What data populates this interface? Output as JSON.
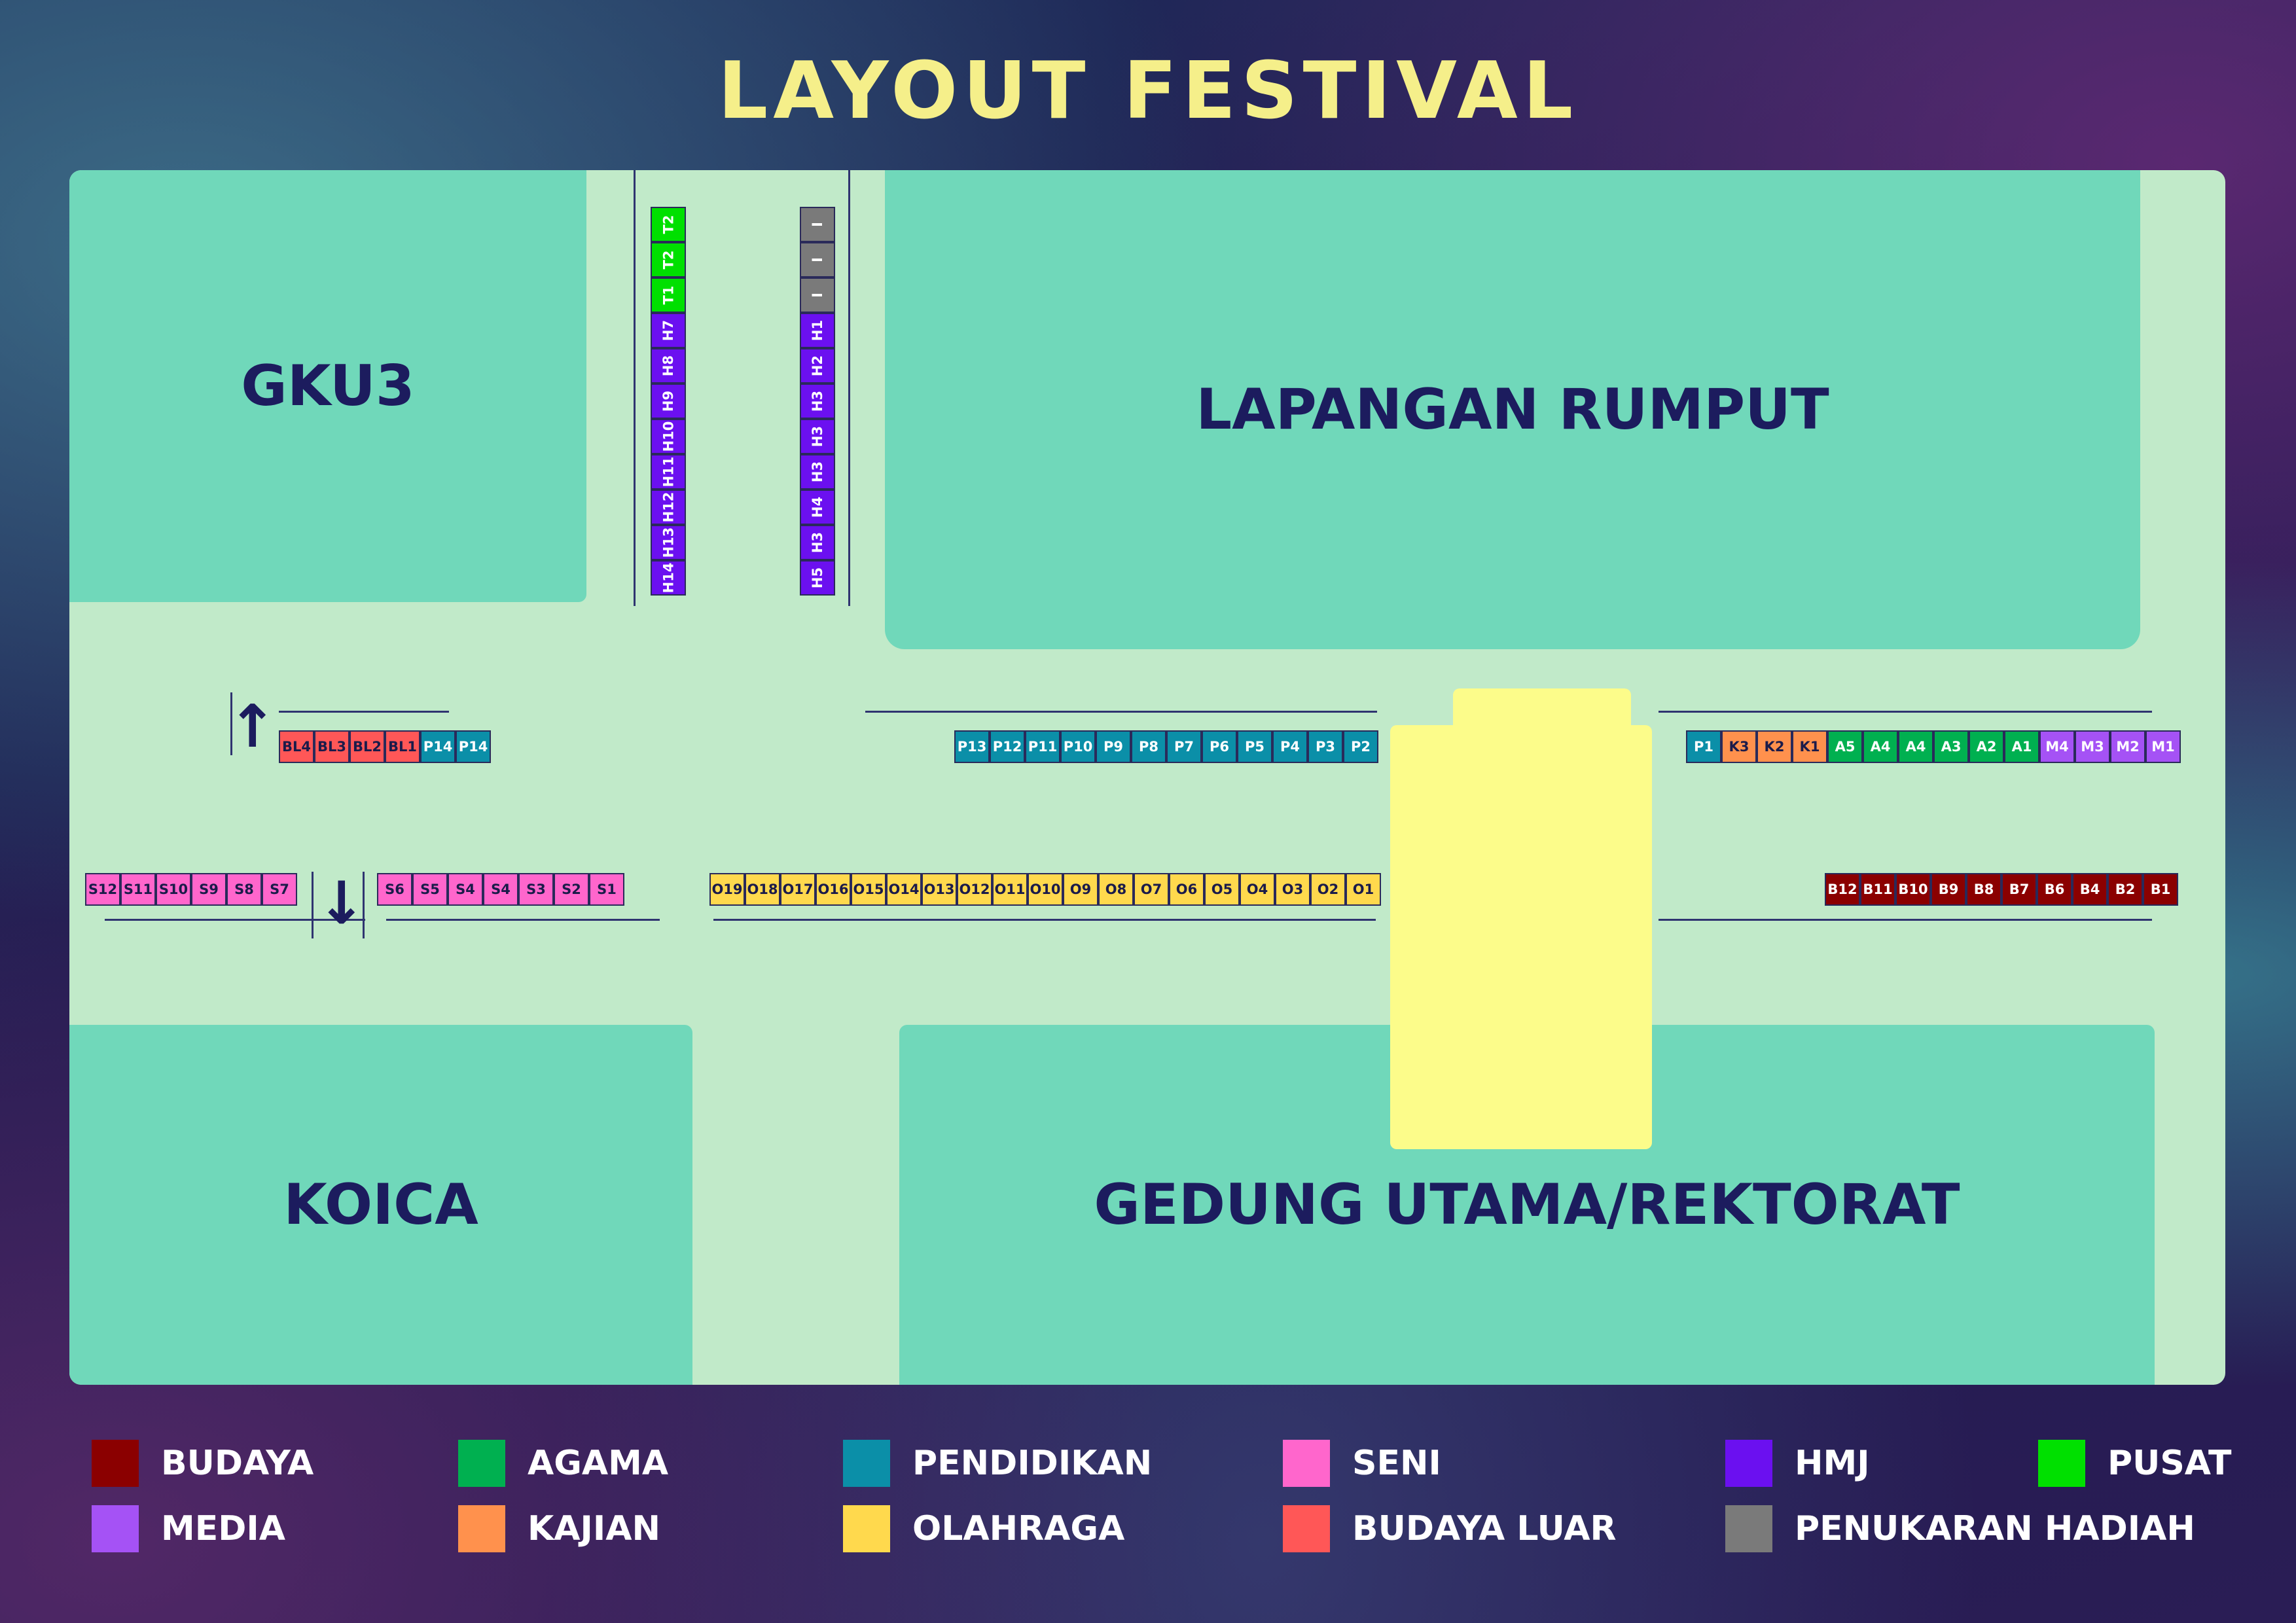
{
  "title": "LAYOUT FESTIVAL",
  "colors": {
    "background": "#1d1a4e",
    "map_ground": "#c1eac9",
    "building": "#70d8ba",
    "title": "#f5ef8a",
    "stage": "#fcfc8a",
    "category_text": "#1c1c5e"
  },
  "buildings": {
    "gku3": "GKU3",
    "lapangan": "LAPANGAN RUMPUT",
    "koica": "KOICA",
    "gedung": "GEDUNG UTAMA/REKTORAT"
  },
  "icons": {
    "arrow_up": "arrow-up-icon",
    "arrow_down": "arrow-down-icon"
  },
  "legend": [
    {
      "label": "BUDAYA",
      "color": "#8b0000"
    },
    {
      "label": "AGAMA",
      "color": "#00b050"
    },
    {
      "label": "PENDIDIKAN",
      "color": "#0b8fa8"
    },
    {
      "label": "SENI",
      "color": "#ff66cc"
    },
    {
      "label": "HMJ",
      "color": "#6b10f0"
    },
    {
      "label": "PUSAT",
      "color": "#00e000"
    },
    {
      "label": "MEDIA",
      "color": "#a552f5"
    },
    {
      "label": "KAJIAN",
      "color": "#ff914d"
    },
    {
      "label": "OLAHRAGA",
      "color": "#ffd94d"
    },
    {
      "label": "BUDAYA LUAR",
      "color": "#ff5757"
    },
    {
      "label": "PENUKARAN HADIAH",
      "color": "#7a7a7a"
    }
  ],
  "stalls": {
    "col_left": [
      {
        "label": "T2",
        "cat": "PUSAT"
      },
      {
        "label": "T2",
        "cat": "PUSAT"
      },
      {
        "label": "T1",
        "cat": "PUSAT"
      },
      {
        "label": "H7",
        "cat": "HMJ"
      },
      {
        "label": "H8",
        "cat": "HMJ"
      },
      {
        "label": "H9",
        "cat": "HMJ"
      },
      {
        "label": "H10",
        "cat": "HMJ"
      },
      {
        "label": "H11",
        "cat": "HMJ"
      },
      {
        "label": "H12",
        "cat": "HMJ"
      },
      {
        "label": "H13",
        "cat": "HMJ"
      },
      {
        "label": "H14",
        "cat": "HMJ"
      }
    ],
    "col_right": [
      {
        "label": "I",
        "cat": "PENUKARAN HADIAH"
      },
      {
        "label": "I",
        "cat": "PENUKARAN HADIAH"
      },
      {
        "label": "I",
        "cat": "PENUKARAN HADIAH"
      },
      {
        "label": "H1",
        "cat": "HMJ"
      },
      {
        "label": "H2",
        "cat": "HMJ"
      },
      {
        "label": "H3",
        "cat": "HMJ"
      },
      {
        "label": "H3",
        "cat": "HMJ"
      },
      {
        "label": "H3",
        "cat": "HMJ"
      },
      {
        "label": "H4",
        "cat": "HMJ"
      },
      {
        "label": "H3",
        "cat": "HMJ"
      },
      {
        "label": "H5",
        "cat": "HMJ"
      }
    ],
    "row_bl": [
      {
        "label": "BL4",
        "cat": "BUDAYA LUAR"
      },
      {
        "label": "BL3",
        "cat": "BUDAYA LUAR"
      },
      {
        "label": "BL2",
        "cat": "BUDAYA LUAR"
      },
      {
        "label": "BL1",
        "cat": "BUDAYA LUAR"
      },
      {
        "label": "P14",
        "cat": "PENDIDIKAN"
      },
      {
        "label": "P14",
        "cat": "PENDIDIKAN"
      }
    ],
    "row_p": [
      {
        "label": "P13",
        "cat": "PENDIDIKAN"
      },
      {
        "label": "P12",
        "cat": "PENDIDIKAN"
      },
      {
        "label": "P11",
        "cat": "PENDIDIKAN"
      },
      {
        "label": "P10",
        "cat": "PENDIDIKAN"
      },
      {
        "label": "P9",
        "cat": "PENDIDIKAN"
      },
      {
        "label": "P8",
        "cat": "PENDIDIKAN"
      },
      {
        "label": "P7",
        "cat": "PENDIDIKAN"
      },
      {
        "label": "P6",
        "cat": "PENDIDIKAN"
      },
      {
        "label": "P5",
        "cat": "PENDIDIKAN"
      },
      {
        "label": "P4",
        "cat": "PENDIDIKAN"
      },
      {
        "label": "P3",
        "cat": "PENDIDIKAN"
      },
      {
        "label": "P2",
        "cat": "PENDIDIKAN"
      }
    ],
    "row_right_top": [
      {
        "label": "P1",
        "cat": "PENDIDIKAN"
      },
      {
        "label": "K3",
        "cat": "KAJIAN"
      },
      {
        "label": "K2",
        "cat": "KAJIAN"
      },
      {
        "label": "K1",
        "cat": "KAJIAN"
      },
      {
        "label": "A5",
        "cat": "AGAMA"
      },
      {
        "label": "A4",
        "cat": "AGAMA"
      },
      {
        "label": "A4",
        "cat": "AGAMA"
      },
      {
        "label": "A3",
        "cat": "AGAMA"
      },
      {
        "label": "A2",
        "cat": "AGAMA"
      },
      {
        "label": "A1",
        "cat": "AGAMA"
      },
      {
        "label": "M4",
        "cat": "MEDIA"
      },
      {
        "label": "M3",
        "cat": "MEDIA"
      },
      {
        "label": "M2",
        "cat": "MEDIA"
      },
      {
        "label": "M1",
        "cat": "MEDIA"
      }
    ],
    "row_s_left": [
      {
        "label": "S12",
        "cat": "SENI"
      },
      {
        "label": "S11",
        "cat": "SENI"
      },
      {
        "label": "S10",
        "cat": "SENI"
      },
      {
        "label": "S9",
        "cat": "SENI"
      },
      {
        "label": "S8",
        "cat": "SENI"
      },
      {
        "label": "S7",
        "cat": "SENI"
      }
    ],
    "row_s_right": [
      {
        "label": "S6",
        "cat": "SENI"
      },
      {
        "label": "S5",
        "cat": "SENI"
      },
      {
        "label": "S4",
        "cat": "SENI"
      },
      {
        "label": "S4",
        "cat": "SENI"
      },
      {
        "label": "S3",
        "cat": "SENI"
      },
      {
        "label": "S2",
        "cat": "SENI"
      },
      {
        "label": "S1",
        "cat": "SENI"
      }
    ],
    "row_o": [
      {
        "label": "O19",
        "cat": "OLAHRAGA"
      },
      {
        "label": "O18",
        "cat": "OLAHRAGA"
      },
      {
        "label": "O17",
        "cat": "OLAHRAGA"
      },
      {
        "label": "O16",
        "cat": "OLAHRAGA"
      },
      {
        "label": "O15",
        "cat": "OLAHRAGA"
      },
      {
        "label": "O14",
        "cat": "OLAHRAGA"
      },
      {
        "label": "O13",
        "cat": "OLAHRAGA"
      },
      {
        "label": "O12",
        "cat": "OLAHRAGA"
      },
      {
        "label": "O11",
        "cat": "OLAHRAGA"
      },
      {
        "label": "O10",
        "cat": "OLAHRAGA"
      },
      {
        "label": "O9",
        "cat": "OLAHRAGA"
      },
      {
        "label": "O8",
        "cat": "OLAHRAGA"
      },
      {
        "label": "O7",
        "cat": "OLAHRAGA"
      },
      {
        "label": "O6",
        "cat": "OLAHRAGA"
      },
      {
        "label": "O5",
        "cat": "OLAHRAGA"
      },
      {
        "label": "O4",
        "cat": "OLAHRAGA"
      },
      {
        "label": "O3",
        "cat": "OLAHRAGA"
      },
      {
        "label": "O2",
        "cat": "OLAHRAGA"
      },
      {
        "label": "O1",
        "cat": "OLAHRAGA"
      }
    ],
    "row_b": [
      {
        "label": "B12",
        "cat": "BUDAYA"
      },
      {
        "label": "B11",
        "cat": "BUDAYA"
      },
      {
        "label": "B10",
        "cat": "BUDAYA"
      },
      {
        "label": "B9",
        "cat": "BUDAYA"
      },
      {
        "label": "B8",
        "cat": "BUDAYA"
      },
      {
        "label": "B7",
        "cat": "BUDAYA"
      },
      {
        "label": "B6",
        "cat": "BUDAYA"
      },
      {
        "label": "B4",
        "cat": "BUDAYA"
      },
      {
        "label": "B2",
        "cat": "BUDAYA"
      },
      {
        "label": "B1",
        "cat": "BUDAYA"
      }
    ]
  }
}
